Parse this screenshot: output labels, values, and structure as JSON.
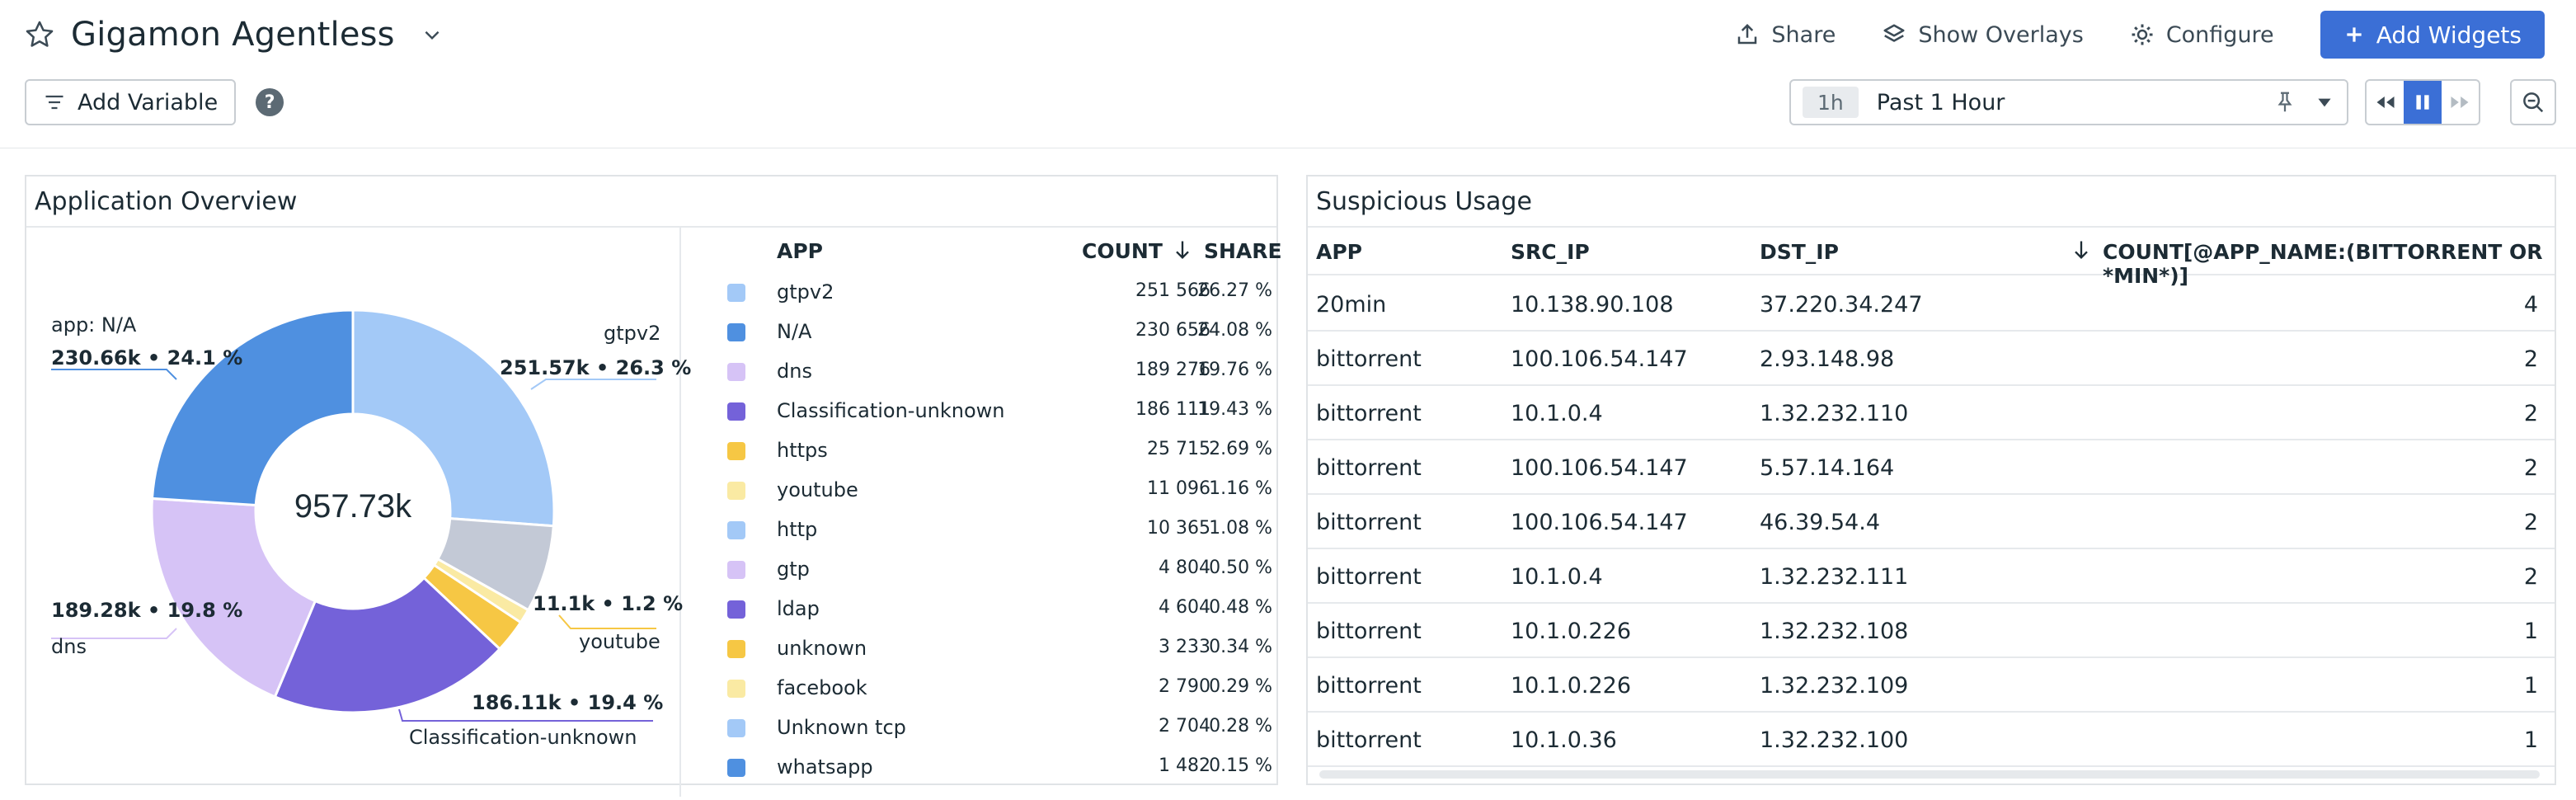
{
  "header": {
    "title": "Gigamon Agentless",
    "actions": {
      "share": "Share",
      "overlays": "Show Overlays",
      "configure": "Configure",
      "add_widgets": "Add Widgets"
    },
    "add_variable": "Add Variable",
    "help": "?",
    "time": {
      "badge": "1h",
      "label": "Past 1 Hour"
    }
  },
  "app_overview": {
    "title": "Application Overview",
    "center_total": "957.73k",
    "labels": {
      "na_name": "app: N/A",
      "na_value": "230.66k • 24.1 %",
      "gtpv2_name": "gtpv2",
      "gtpv2_value": "251.57k • 26.3 %",
      "youtube_value": "11.1k • 1.2 %",
      "youtube_name": "youtube",
      "dns_value": "189.28k • 19.8 %",
      "dns_name": "dns",
      "cu_value": "186.11k • 19.4 %",
      "cu_name": "Classification-unknown"
    },
    "legend_headers": {
      "app": "APP",
      "count": "COUNT",
      "share": "SHARE"
    },
    "legend": [
      {
        "name": "gtpv2",
        "count": "251 566",
        "share": "26.27 %",
        "color": "#a3c9f7"
      },
      {
        "name": "N/A",
        "count": "230 656",
        "share": "24.08 %",
        "color": "#4f90e0"
      },
      {
        "name": "dns",
        "count": "189 276",
        "share": "19.76 %",
        "color": "#d6c3f6"
      },
      {
        "name": "Classification-unknown",
        "count": "186 111",
        "share": "19.43 %",
        "color": "#7462d9"
      },
      {
        "name": "https",
        "count": "25 715",
        "share": "2.69 %",
        "color": "#f6c744"
      },
      {
        "name": "youtube",
        "count": "11 096",
        "share": "1.16 %",
        "color": "#faeaa3"
      },
      {
        "name": "http",
        "count": "10 365",
        "share": "1.08 %",
        "color": "#a3c9f7"
      },
      {
        "name": "gtp",
        "count": "4 804",
        "share": "0.50 %",
        "color": "#d6c3f6"
      },
      {
        "name": "ldap",
        "count": "4 604",
        "share": "0.48 %",
        "color": "#7462d9"
      },
      {
        "name": "unknown",
        "count": "3 233",
        "share": "0.34 %",
        "color": "#f6c744"
      },
      {
        "name": "facebook",
        "count": "2 790",
        "share": "0.29 %",
        "color": "#faeaa3"
      },
      {
        "name": "Unknown tcp",
        "count": "2 704",
        "share": "0.28 %",
        "color": "#a3c9f7"
      },
      {
        "name": "whatsapp",
        "count": "1 482",
        "share": "0.15 %",
        "color": "#4f90e0"
      }
    ]
  },
  "suspicious": {
    "title": "Suspicious Usage",
    "headers": {
      "app": "APP",
      "src": "SRC_IP",
      "dst": "DST_IP",
      "count": "COUNT[@APP_NAME:(BITTORRENT OR *MIN*)]"
    },
    "rows": [
      {
        "app": "20min",
        "src": "10.138.90.108",
        "dst": "37.220.34.247",
        "count": "4"
      },
      {
        "app": "bittorrent",
        "src": "100.106.54.147",
        "dst": "2.93.148.98",
        "count": "2"
      },
      {
        "app": "bittorrent",
        "src": "10.1.0.4",
        "dst": "1.32.232.110",
        "count": "2"
      },
      {
        "app": "bittorrent",
        "src": "100.106.54.147",
        "dst": "5.57.14.164",
        "count": "2"
      },
      {
        "app": "bittorrent",
        "src": "100.106.54.147",
        "dst": "46.39.54.4",
        "count": "2"
      },
      {
        "app": "bittorrent",
        "src": "10.1.0.4",
        "dst": "1.32.232.111",
        "count": "2"
      },
      {
        "app": "bittorrent",
        "src": "10.1.0.226",
        "dst": "1.32.232.108",
        "count": "1"
      },
      {
        "app": "bittorrent",
        "src": "10.1.0.226",
        "dst": "1.32.232.109",
        "count": "1"
      },
      {
        "app": "bittorrent",
        "src": "10.1.0.36",
        "dst": "1.32.232.100",
        "count": "1"
      }
    ]
  },
  "chart_data": {
    "type": "pie",
    "categories": [
      "gtpv2",
      "N/A",
      "dns",
      "Classification-unknown",
      "https",
      "youtube",
      "http",
      "gtp",
      "ldap",
      "unknown",
      "facebook",
      "Unknown tcp",
      "whatsapp"
    ],
    "values": [
      251566,
      230656,
      189276,
      186111,
      25715,
      11096,
      10365,
      4804,
      4604,
      3233,
      2790,
      2704,
      1482
    ],
    "other_value": 37330,
    "colors": [
      "#a3c9f7",
      "#4f90e0",
      "#d6c3f6",
      "#7462d9",
      "#f6c744",
      "#faeaa3",
      "#a3c9f7",
      "#d6c3f6",
      "#7462d9",
      "#f6c744",
      "#faeaa3",
      "#a3c9f7",
      "#4f90e0"
    ],
    "other_color": "#c3c9d6",
    "title": "Application Overview"
  }
}
